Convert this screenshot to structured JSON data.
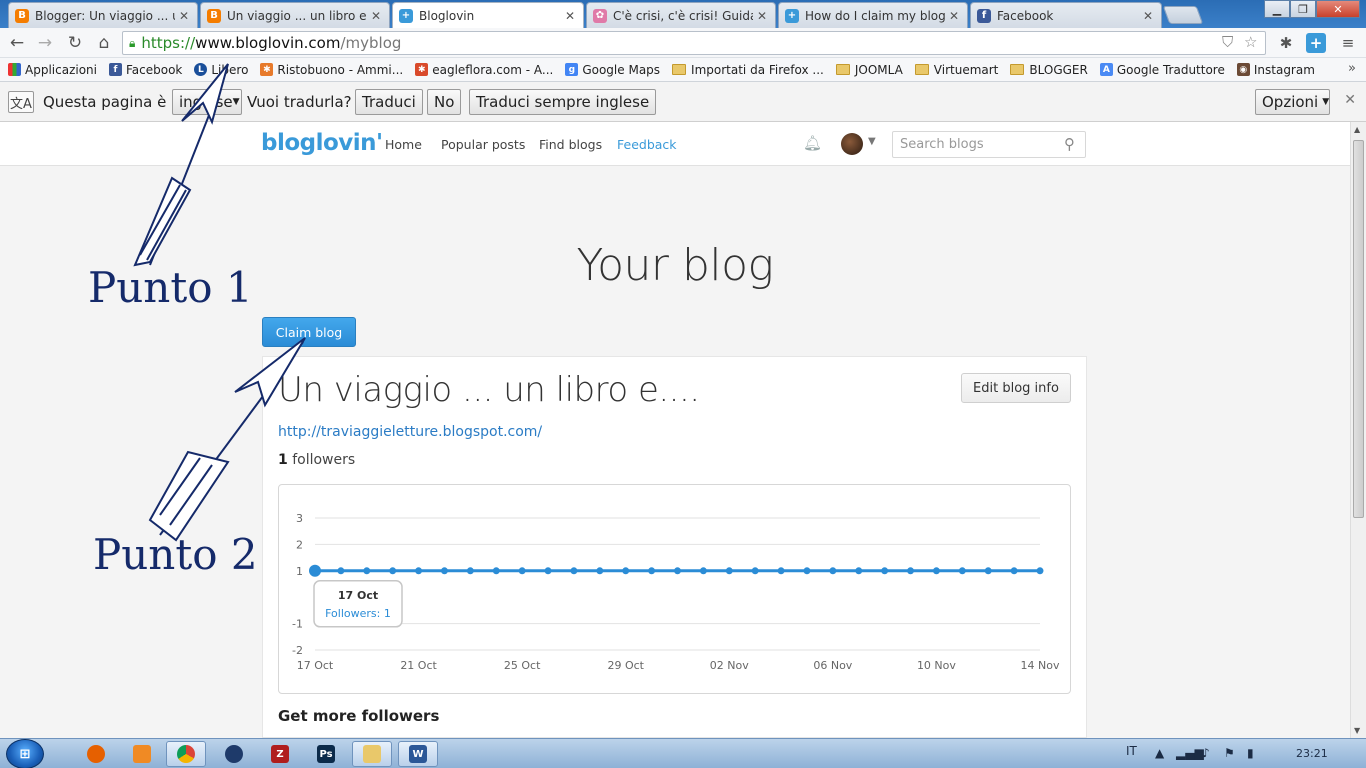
{
  "tabs": [
    {
      "title": "Blogger: Un viaggio ... un",
      "icon": "blogger-icon"
    },
    {
      "title": "Un viaggio ... un libro e....",
      "icon": "blogger-icon"
    },
    {
      "title": "Bloglovin",
      "icon": "bloglovin-icon"
    },
    {
      "title": "C'è crisi, c'è crisi! Guida all",
      "icon": "flower-icon"
    },
    {
      "title": "How do I claim my blog?",
      "icon": "bloglovin-icon"
    },
    {
      "title": "Facebook",
      "icon": "facebook-icon"
    }
  ],
  "url": {
    "scheme": "https://",
    "host": "www.bloglovin.com",
    "path": "/myblog"
  },
  "bookmarks": [
    {
      "label": "Applicazioni",
      "icon": "apps-grid-icon"
    },
    {
      "label": "Facebook",
      "icon": "facebook-icon"
    },
    {
      "label": "Libero",
      "icon": "libero-icon"
    },
    {
      "label": "Ristobuono - Ammi...",
      "icon": "joomla-icon"
    },
    {
      "label": "eagleflora.com - A...",
      "icon": "joomla-icon"
    },
    {
      "label": "Google Maps",
      "icon": "google-icon"
    },
    {
      "label": "Importati da Firefox ...",
      "icon": "folder-icon"
    },
    {
      "label": "JOOMLA",
      "icon": "folder-icon"
    },
    {
      "label": "Virtuemart",
      "icon": "folder-icon"
    },
    {
      "label": "BLOGGER",
      "icon": "folder-icon"
    },
    {
      "label": "Google Traduttore",
      "icon": "translate-icon"
    },
    {
      "label": "Instagram",
      "icon": "instagram-icon"
    }
  ],
  "translate": {
    "question": "Questa pagina è in",
    "language": "inglese",
    "ask": "Vuoi tradurla?",
    "translate_btn": "Traduci",
    "no_btn": "No",
    "always_btn": "Traduci sempre inglese",
    "options_btn": "Opzioni"
  },
  "site": {
    "logo": "bloglovin'",
    "nav": [
      "Home",
      "Popular posts",
      "Find blogs",
      "Feedback"
    ],
    "search_placeholder": "Search blogs"
  },
  "page": {
    "title": "Your blog",
    "claim_btn": "Claim blog",
    "edit_btn": "Edit blog info",
    "blog_name": "Un viaggio ... un libro e....",
    "blog_url": "http://traviaggieletture.blogspot.com/",
    "followers_count": "1",
    "followers_label": "followers",
    "more_followers": "Get more followers"
  },
  "chart_data": {
    "type": "line",
    "x_ticks": [
      "17 Oct",
      "21 Oct",
      "25 Oct",
      "29 Oct",
      "02 Nov",
      "06 Nov",
      "10 Nov",
      "14 Nov"
    ],
    "y_ticks": [
      "3",
      "2",
      "1",
      "-1",
      "-2"
    ],
    "ylim": [
      -2,
      3
    ],
    "x": [
      "17 Oct",
      "18 Oct",
      "19 Oct",
      "20 Oct",
      "21 Oct",
      "22 Oct",
      "23 Oct",
      "24 Oct",
      "25 Oct",
      "26 Oct",
      "27 Oct",
      "28 Oct",
      "29 Oct",
      "30 Oct",
      "31 Oct",
      "01 Nov",
      "02 Nov",
      "03 Nov",
      "04 Nov",
      "05 Nov",
      "06 Nov",
      "07 Nov",
      "08 Nov",
      "09 Nov",
      "10 Nov",
      "11 Nov",
      "12 Nov",
      "13 Nov",
      "14 Nov"
    ],
    "values": [
      1,
      1,
      1,
      1,
      1,
      1,
      1,
      1,
      1,
      1,
      1,
      1,
      1,
      1,
      1,
      1,
      1,
      1,
      1,
      1,
      1,
      1,
      1,
      1,
      1,
      1,
      1,
      1,
      1
    ],
    "color": "#2b8cd6",
    "tooltip": {
      "date": "17 Oct",
      "text": "Followers: 1"
    }
  },
  "annotations": {
    "point1": "Punto 1",
    "point2": "Punto 2"
  },
  "taskbar": {
    "lang": "IT",
    "time": "23:21"
  }
}
